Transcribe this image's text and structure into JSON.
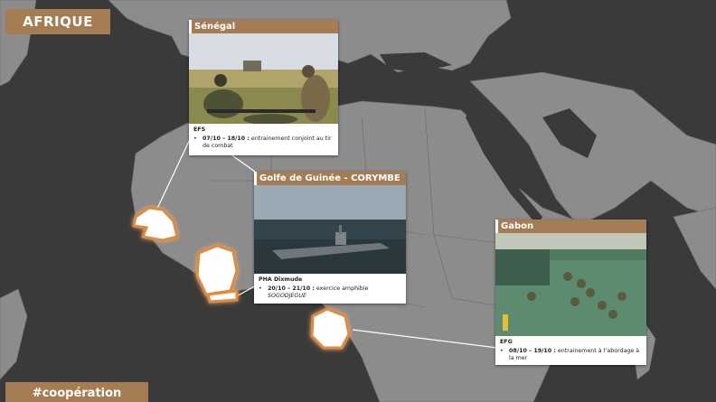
{
  "header": {
    "title": "AFRIQUE"
  },
  "footer": {
    "tag": "#coopération"
  },
  "colors": {
    "accent": "#a57c53",
    "map_background": "#3c3c3c",
    "land": "#8a8a8a",
    "highlight_glow": "#e08a3c"
  },
  "cards": {
    "senegal": {
      "title": "Sénégal",
      "unit": "EFS",
      "bullet_bold": "07/10 – 18/10 :",
      "bullet_text": " entrainement conjoint au tir de combat"
    },
    "guinee": {
      "title": "Golfe de Guinée - CORYMBE",
      "unit": "PHA Dixmude",
      "bullet_bold": "20/10 – 21/10 :",
      "bullet_text": " exercice amphibie ",
      "bullet_italic": "SOGODJEGUE"
    },
    "gabon": {
      "title": "Gabon",
      "unit": "EFG",
      "bullet_bold": "08/10 – 19/10 :",
      "bullet_text": " entrainement à l’abordage à la mer"
    }
  },
  "bullet_glyph": "•"
}
